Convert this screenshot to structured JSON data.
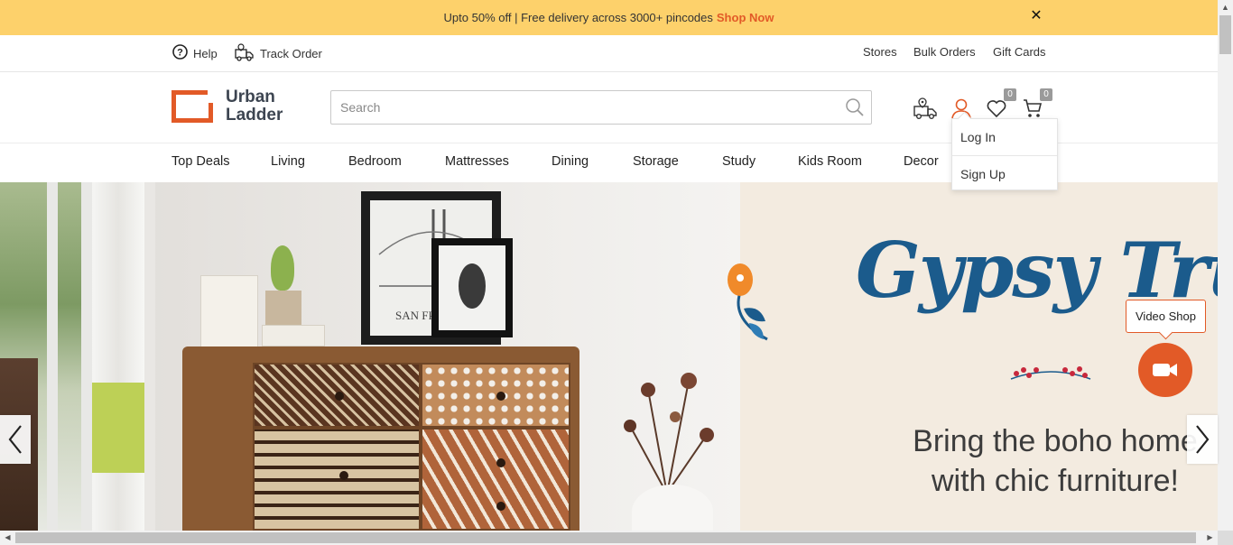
{
  "promo": {
    "text": "Upto 50% off | Free delivery across 3000+ pincodes",
    "link": "Shop Now",
    "close": "✕"
  },
  "util": {
    "help": "Help",
    "track_order": "Track Order",
    "stores": "Stores",
    "bulk_orders": "Bulk Orders",
    "gift_cards": "Gift Cards"
  },
  "header": {
    "logo_line1": "Urban",
    "logo_line2": "Ladder",
    "search_placeholder": "Search",
    "wishlist_count": "0",
    "cart_count": "0"
  },
  "account_menu": {
    "login": "Log In",
    "signup": "Sign Up"
  },
  "nav": {
    "items": [
      "Top Deals",
      "Living",
      "Bedroom",
      "Mattresses",
      "Dining",
      "Storage",
      "Study",
      "Kids Room",
      "Decor"
    ]
  },
  "hero": {
    "title": "Gypsy Trunk",
    "tagline_line1": "Bring the boho home",
    "tagline_line2": "with chic furniture!",
    "frame_text": "SAN FRA"
  },
  "video_shop": {
    "label": "Video Shop"
  },
  "colors": {
    "accent": "#e25a27",
    "promo_bg": "#fdd16b",
    "hero_title": "#1b5b8c"
  }
}
